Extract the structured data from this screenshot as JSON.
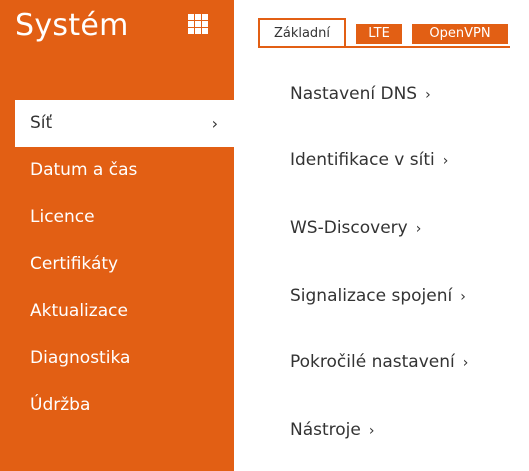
{
  "sidebar": {
    "title": "Systém",
    "menu_icon": "grid-icon",
    "items": [
      {
        "label": "Síť",
        "active": true,
        "chevron": "›"
      },
      {
        "label": "Datum a čas"
      },
      {
        "label": "Licence"
      },
      {
        "label": "Certifikáty"
      },
      {
        "label": "Aktualizace"
      },
      {
        "label": "Diagnostika"
      },
      {
        "label": "Údržba"
      }
    ]
  },
  "tabs": [
    {
      "label": "Základní",
      "active": true
    },
    {
      "label": "LTE"
    },
    {
      "label": "OpenVPN"
    }
  ],
  "links": [
    {
      "label": "Nastavení DNS",
      "chevron": "›"
    },
    {
      "label": "Identifikace v síti",
      "chevron": "›"
    },
    {
      "label": "WS-Discovery",
      "chevron": "›"
    },
    {
      "label": "Signalizace spojení",
      "chevron": "›"
    },
    {
      "label": "Pokročilé nastavení",
      "chevron": "›"
    },
    {
      "label": "Nástroje",
      "chevron": "›"
    }
  ],
  "colors": {
    "accent": "#e25f14",
    "text": "#333333",
    "background": "#ffffff"
  }
}
